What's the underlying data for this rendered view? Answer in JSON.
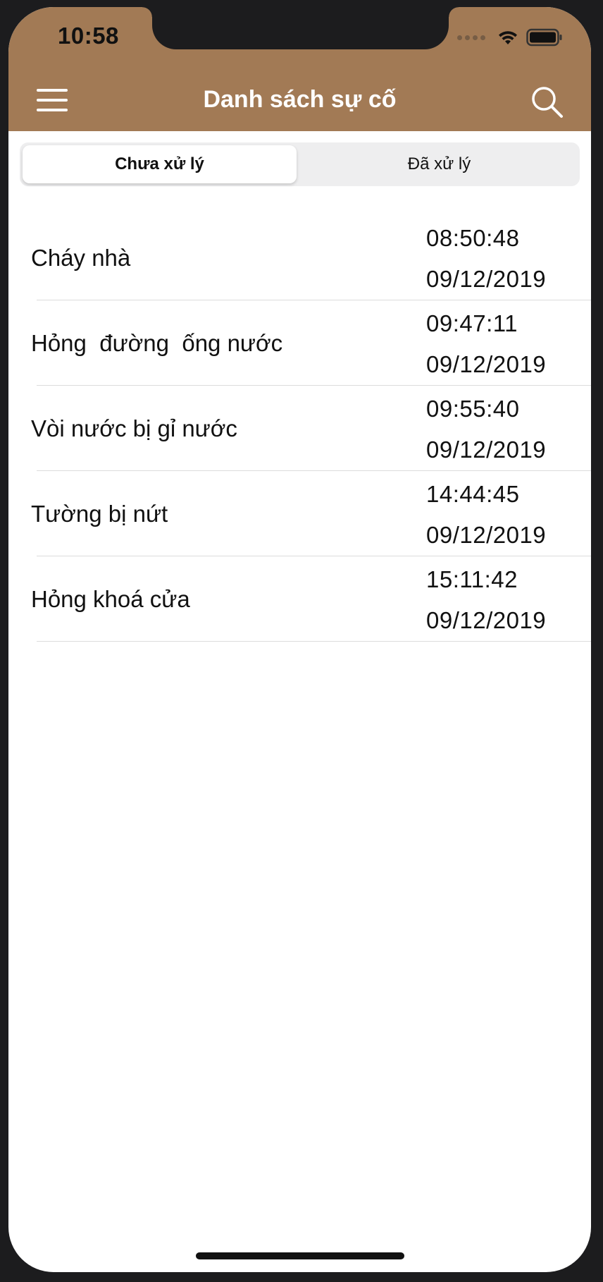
{
  "status_bar": {
    "time": "10:58"
  },
  "nav": {
    "title": "Danh sách sự cố",
    "menu_icon": "hamburger-menu-icon",
    "search_icon": "search-icon",
    "bar_color": "#a27a55"
  },
  "tabs": [
    {
      "label": "Chưa xử lý",
      "selected": true
    },
    {
      "label": "Đã xử lý",
      "selected": false
    }
  ],
  "incidents": [
    {
      "name": "Cháy nhà",
      "time": "08:50:48",
      "date": "09/12/2019"
    },
    {
      "name": "Hỏng  đường  ống nước",
      "time": "09:47:11",
      "date": "09/12/2019"
    },
    {
      "name": "Vòi nước bị gỉ nước",
      "time": "09:55:40",
      "date": "09/12/2019"
    },
    {
      "name": "Tường bị nứt",
      "time": "14:44:45",
      "date": "09/12/2019"
    },
    {
      "name": "Hỏng khoá cửa",
      "time": "15:11:42",
      "date": "09/12/2019"
    }
  ]
}
